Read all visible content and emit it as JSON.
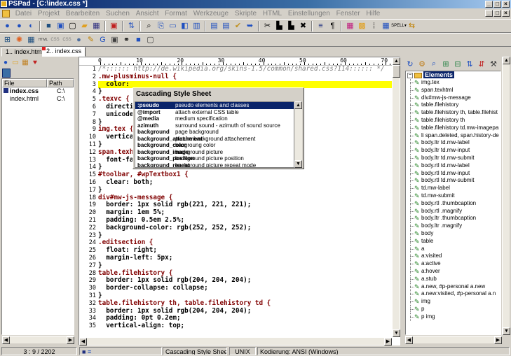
{
  "window": {
    "title": "PSPad - [C:\\index.css *]",
    "controls": [
      "_",
      "□",
      "×"
    ]
  },
  "menu": [
    "Datei",
    "Projekt",
    "Bearbeiten",
    "Suchen",
    "Ansicht",
    "Format",
    "Werkzeuge",
    "Skripte",
    "HTML",
    "Einstellungen",
    "Fenster",
    "Hilfe"
  ],
  "toolbar1": [
    "new-icon",
    "open-icon",
    "save-icon",
    "print-icon",
    "undo-icon",
    "redo-icon",
    "find-icon",
    "replace-icon",
    "bookmark-icon",
    "cut-icon",
    "copy-icon",
    "paste-icon",
    "delete-icon",
    "compare-icon",
    "wrap-icon",
    "spell-icon"
  ],
  "toolbar2": [
    "html-icon",
    "css-icon",
    "color-icon",
    "table-icon",
    "preview-icon"
  ],
  "tabs": [
    {
      "label": "1.. index.html"
    },
    {
      "label": "2.. index.css"
    }
  ],
  "files": {
    "headers": [
      "File",
      "Path"
    ],
    "rows": [
      {
        "name": "index.css",
        "path": "C:\\"
      },
      {
        "name": "index.html",
        "path": "C:\\"
      }
    ]
  },
  "ruler": [
    "0",
    "10",
    "20",
    "30",
    "40",
    "50",
    "60",
    "70"
  ],
  "code": [
    {
      "n": "1",
      "t": "/*:::::: http://de.wikipedia.org/skins-1.5/common/shared.css?114:::::: */"
    },
    {
      "n": "2",
      "t": ".mw-plusminus-null {"
    },
    {
      "n": "3",
      "t": "  color:"
    },
    {
      "n": "4",
      "t": "}"
    },
    {
      "n": "5",
      "t": ".texvc {"
    },
    {
      "n": "6",
      "t": "  directi"
    },
    {
      "n": "7",
      "t": "  unicode"
    },
    {
      "n": "8",
      "t": "}"
    },
    {
      "n": "9",
      "t": "img.tex {"
    },
    {
      "n": "10",
      "t": "  vertica"
    },
    {
      "n": "11",
      "t": "}"
    },
    {
      "n": "12",
      "t": "span.texh"
    },
    {
      "n": "13",
      "t": "  font-fa"
    },
    {
      "n": "14",
      "t": "}"
    },
    {
      "n": "15",
      "t": "#toolbar, #wpTextbox1 {"
    },
    {
      "n": "16",
      "t": "  clear: both;"
    },
    {
      "n": "17",
      "t": "}"
    },
    {
      "n": "18",
      "t": "div#mw-js-message {"
    },
    {
      "n": "19",
      "t": "  border: 1px solid rgb(221, 221, 221);"
    },
    {
      "n": "20",
      "t": "  margin: 1em 5%;"
    },
    {
      "n": "21",
      "t": "  padding: 0.5em 2.5%;"
    },
    {
      "n": "22",
      "t": "  background-color: rgb(252, 252, 252);"
    },
    {
      "n": "23",
      "t": "}"
    },
    {
      "n": "24",
      "t": ".editsection {"
    },
    {
      "n": "25",
      "t": "  float: right;"
    },
    {
      "n": "26",
      "t": "  margin-left: 5px;"
    },
    {
      "n": "27",
      "t": "}"
    },
    {
      "n": "28",
      "t": "table.filehistory {"
    },
    {
      "n": "29",
      "t": "  border: 1px solid rgb(204, 204, 204);"
    },
    {
      "n": "30",
      "t": "  border-collapse: collapse;"
    },
    {
      "n": "31",
      "t": "}"
    },
    {
      "n": "32",
      "t": "table.filehistory th, table.filehistory td {"
    },
    {
      "n": "33",
      "t": "  border: 1px solid rgb(204, 204, 204);"
    },
    {
      "n": "34",
      "t": "  padding: 0pt 0.2em;"
    },
    {
      "n": "35",
      "t": "  vertical-align: top;"
    }
  ],
  "popup": {
    "title": "Cascading Style Sheet",
    "items": [
      {
        "k": ":pseudo",
        "d": "pseudo elements and classes"
      },
      {
        "k": "@import",
        "d": "attach external CSS table"
      },
      {
        "k": "@media",
        "d": "medium specification"
      },
      {
        "k": "azimuth",
        "d": "surround sound - azimuth of sound source"
      },
      {
        "k": "background",
        "d": "page background"
      },
      {
        "k": "background_attachment",
        "d": "picture background attachement"
      },
      {
        "k": "background_color",
        "d": "bacgroung color"
      },
      {
        "k": "background_image",
        "d": "background picture"
      },
      {
        "k": "background_position",
        "d": "background picture position"
      },
      {
        "k": "background_repeat",
        "d": "background picture repeat mode"
      }
    ]
  },
  "tree": {
    "root": "Elements",
    "items": [
      "img.tex",
      "span.texhtml",
      "div#mw-js-message",
      "table.filehistory",
      "table.filehistory th, table.filehist",
      "table.filehistory th",
      "table.filehistory td.mw-imagepa",
      "li span.deleted, span.history-de",
      "body.ltr td.mw-label",
      "body.ltr td.mw-input",
      "body.ltr td.mw-submit",
      "body.rtl td.mw-label",
      "body.rtl td.mw-input",
      "body.rtl td.mw-submit",
      "td.mw-label",
      "td.mw-submit",
      "body.rtl .thumbcaption",
      "body.rtl .magnify",
      "body.ltr .thumbcaption",
      "body.ltr .magnify",
      "body",
      "table",
      "a",
      "a:visited",
      "a:active",
      "a:hover",
      "a.stub",
      "a.new, #p-personal a.new",
      "a.new:visited, #p-personal a.n",
      "img",
      "p",
      "p img"
    ]
  },
  "status": {
    "position": "3 : 9 / 2202",
    "syntax": "Cascading Style Sheet",
    "lineend": "UNIX",
    "encoding": "Kodierung: ANSI (Windows)"
  },
  "colors": {
    "title_start": "#0a246a",
    "highlight_line": "#ffff00",
    "selector": "#800000",
    "value": "#0000c0"
  }
}
